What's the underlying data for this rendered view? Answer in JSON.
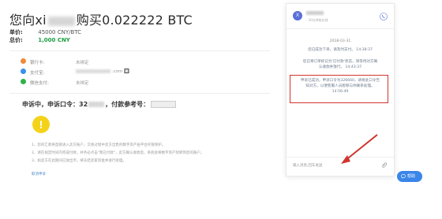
{
  "order": {
    "title_prefix": "您向xi",
    "title_suffix": "购买0.022222 BTC",
    "price_label": "单价:",
    "price_value": "45000 CNY/BTC",
    "total_label": "总价:",
    "total_value": "1,000 CNY"
  },
  "payment_methods": [
    {
      "label": "银行卡:",
      "value": "未绑定",
      "icon": "bank-card-icon",
      "color": "#f08b3c"
    },
    {
      "label": "支付宝:",
      "value_suffix": ".com 🔲",
      "icon": "alipay-icon",
      "color": "#3b8ef0"
    },
    {
      "label": "微信支付:",
      "value": "未绑定",
      "icon": "wechat-pay-icon",
      "color": "#2fb24a"
    }
  ],
  "appeal": {
    "status_text": "申诉中，申诉口令：32",
    "ref_label": "，付款参考号："
  },
  "notes": [
    "1、您的汇款将直接进入卖方账户，交易过程中卖方出售的数字资产由平台托管保护。",
    "2、请在规定时间内完成付款，并务必点击\"我已付款\"，卖方确认收款后，系统会将数字资产划转到您的账户。",
    "3、如卖方在此期间已放出币，将冻结卖家资金并进行处理。"
  ],
  "cancel_link": "取消申诉",
  "chat": {
    "avatar_letter": "X",
    "status": "· 30分钟前在线",
    "date": "2018-03-31",
    "messages": [
      "您已成功下单，请及时支付。 14:38:37",
      "您已将订单标记为'已付款'状态，请等待对方确认收款并放行。 14:43:37",
      "申诉已成功，申诉口令为326660，请将此口令告知对方。以便客服人员能够与你联系处理。 14:56:49"
    ],
    "input_placeholder": "输入消息,回车发送"
  },
  "help_button": "帮助",
  "colors": {
    "accent": "#3a85e8",
    "highlight_border": "#d0342c",
    "success": "#1a9e3f",
    "warning": "#f4d219"
  }
}
